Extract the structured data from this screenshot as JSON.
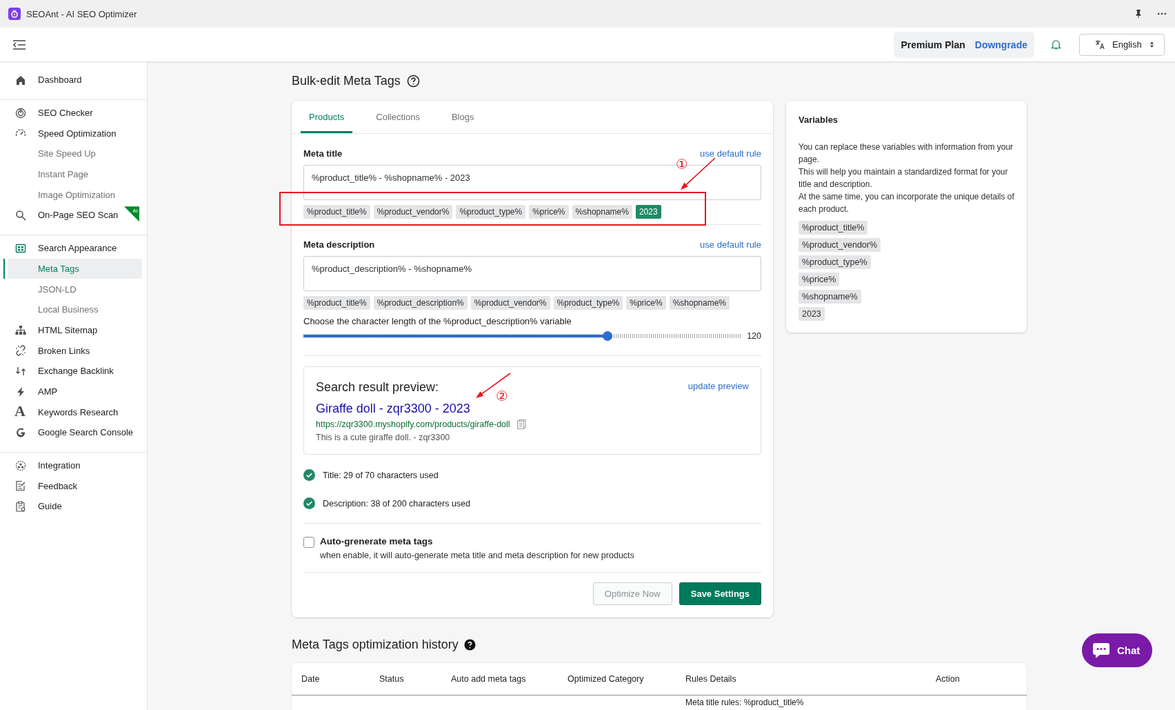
{
  "app_title": "SEOAnt - AI SEO Optimizer",
  "header": {
    "plan": "Premium Plan",
    "plan_action": "Downgrade",
    "language": "English"
  },
  "sidebar": {
    "groups": [
      [
        {
          "label": "Dashboard",
          "kind": "main",
          "selected": false
        }
      ],
      [
        {
          "label": "SEO Checker",
          "kind": "main",
          "selected": false
        },
        {
          "label": "Speed Optimization",
          "kind": "main",
          "selected": false
        },
        {
          "label": "Site Speed Up",
          "kind": "sub",
          "selected": false
        },
        {
          "label": "Instant Page",
          "kind": "sub",
          "selected": false
        },
        {
          "label": "Image Optimization",
          "kind": "sub",
          "selected": false
        },
        {
          "label": "On-Page SEO Scan",
          "kind": "main",
          "selected": false,
          "badge": "AI"
        }
      ],
      [
        {
          "label": "Search Appearance",
          "kind": "main",
          "selected": false
        },
        {
          "label": "Meta Tags",
          "kind": "sub",
          "selected": true
        },
        {
          "label": "JSON-LD",
          "kind": "sub",
          "selected": false
        },
        {
          "label": "Local Business",
          "kind": "sub",
          "selected": false
        },
        {
          "label": "HTML Sitemap",
          "kind": "main",
          "selected": false
        },
        {
          "label": "Broken Links",
          "kind": "main",
          "selected": false
        },
        {
          "label": "Exchange Backlink",
          "kind": "main",
          "selected": false
        },
        {
          "label": "AMP",
          "kind": "main",
          "selected": false
        },
        {
          "label": "Keywords Research",
          "kind": "main",
          "selected": false,
          "glyph": "A"
        },
        {
          "label": "Google Search Console",
          "kind": "main",
          "selected": false
        }
      ],
      [
        {
          "label": "Integration",
          "kind": "main",
          "selected": false
        },
        {
          "label": "Feedback",
          "kind": "main",
          "selected": false
        },
        {
          "label": "Guide",
          "kind": "main",
          "selected": false
        }
      ]
    ]
  },
  "page_title": "Bulk-edit Meta Tags",
  "editor": {
    "tabs": [
      {
        "label": "Products",
        "selected": true
      },
      {
        "label": "Collections",
        "selected": false
      },
      {
        "label": "Blogs",
        "selected": false
      }
    ],
    "meta_title": {
      "label": "Meta title",
      "action": "use default rule",
      "value": "%product_title% - %shopname% - 2023",
      "chips": [
        {
          "label": "%product_title%",
          "selected": false
        },
        {
          "label": "%product_vendor%",
          "selected": false
        },
        {
          "label": "%product_type%",
          "selected": false
        },
        {
          "label": "%price%",
          "selected": false
        },
        {
          "label": "%shopname%",
          "selected": false
        },
        {
          "label": "2023",
          "selected": true
        }
      ]
    },
    "meta_description": {
      "label": "Meta description",
      "action": "use default rule",
      "value": "%product_description% - %shopname%",
      "chips": [
        {
          "label": "%product_title%",
          "selected": false
        },
        {
          "label": "%product_description%",
          "selected": false
        },
        {
          "label": "%product_vendor%",
          "selected": false
        },
        {
          "label": "%product_type%",
          "selected": false
        },
        {
          "label": "%price%",
          "selected": false
        },
        {
          "label": "%shopname%",
          "selected": false
        }
      ]
    },
    "slider": {
      "caption": "Choose the character length of the %product_description% variable",
      "level": 0.695,
      "reading": "120"
    },
    "preview": {
      "heading": "Search result preview:",
      "action": "update preview",
      "link_title": "Giraffe doll - zqr3300 - 2023",
      "url": "https://zqr3300.myshopify.com/products/giraffe-doll",
      "snippet": "This is a cute giraffe doll. - zqr3300"
    },
    "checks": [
      "Title: 29 of 70 characters used",
      "Description: 38 of 200 characters used"
    ],
    "auto_generate": {
      "label": "Auto-grenerate meta tags",
      "hint": "when enable, it will auto-generate meta title and meta description for new products",
      "checked": false
    },
    "buttons": [
      {
        "label": "Optimize Now",
        "kind": "secondary"
      },
      {
        "label": "Save Settings",
        "kind": "primary"
      }
    ]
  },
  "variables": {
    "title": "Variables",
    "paragraphs": [
      "You can replace these variables with information from your page.",
      "This will help you maintain a standardized format for your title and description.",
      "At the same time, you can incorporate the unique details of each product."
    ],
    "chips": [
      "%product_title%",
      "%product_vendor%",
      "%product_type%",
      "%price%",
      "%shopname%",
      "2023"
    ]
  },
  "history": {
    "title": "Meta Tags optimization history",
    "columns": [
      "Date",
      "Status",
      "Auto add meta tags",
      "Optimized Category",
      "Rules Details",
      "Action"
    ],
    "row_peek": "Meta title rules: %product_title%"
  },
  "chat": "Chat",
  "annotations": [
    {
      "kind": "box"
    },
    {
      "kind": "arrow",
      "label": "①"
    },
    {
      "kind": "arrow",
      "label": "②"
    }
  ]
}
